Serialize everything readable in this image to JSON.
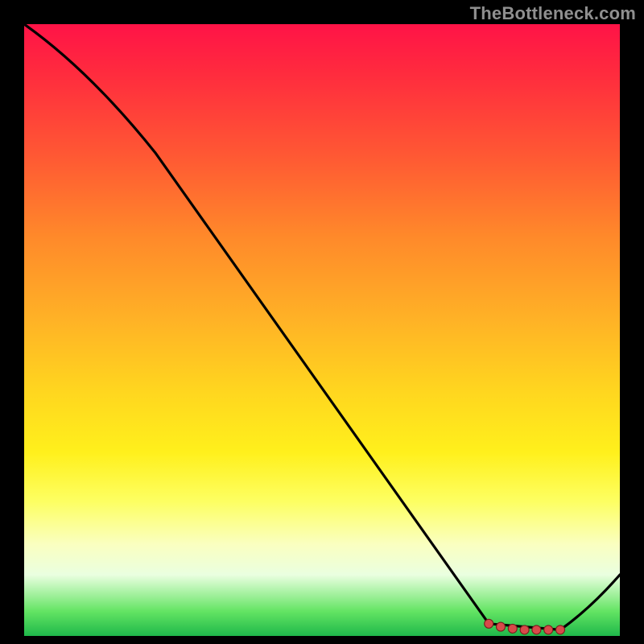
{
  "watermark": "TheBottleneck.com",
  "colors": {
    "background": "#000000",
    "curve": "#000000",
    "marker_fill": "#d84a4a",
    "marker_stroke": "#7a1c1c"
  },
  "chart_data": {
    "type": "line",
    "title": "",
    "xlabel": "",
    "ylabel": "",
    "xlim": [
      0,
      100
    ],
    "ylim": [
      0,
      100
    ],
    "grid": false,
    "x": [
      0,
      22,
      78,
      90,
      100
    ],
    "values": [
      100,
      79,
      2,
      1,
      10
    ],
    "markers": {
      "x": [
        78,
        80,
        82,
        84,
        86,
        88,
        90
      ],
      "y": [
        2,
        1.5,
        1.2,
        1,
        1,
        1,
        1
      ]
    },
    "note": "Values read visually from a gradient-background bottleneck chart; the curve descends from top-left toward a minimum near x≈85 then rises slightly at the right edge."
  }
}
